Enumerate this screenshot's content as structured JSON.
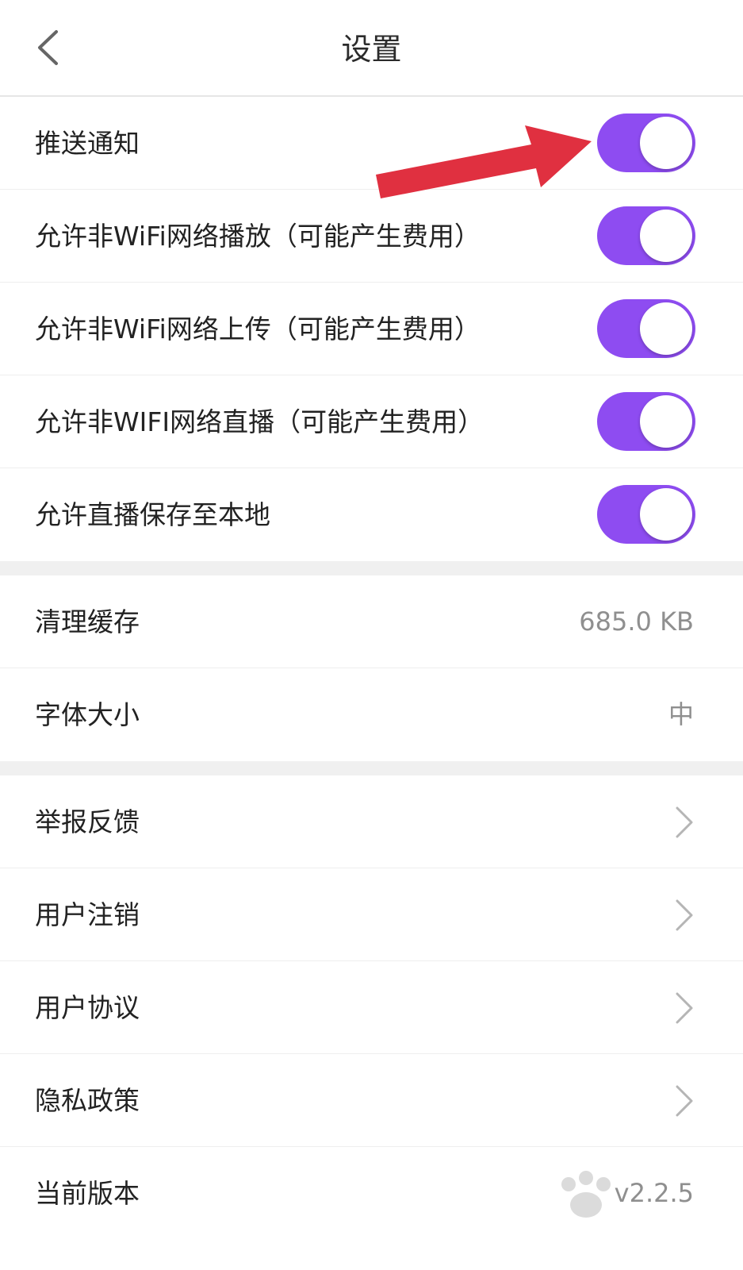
{
  "header": {
    "title": "设置"
  },
  "toggles": [
    {
      "label": "推送通知",
      "on": true
    },
    {
      "label": "允许非WiFi网络播放（可能产生费用）",
      "on": true
    },
    {
      "label": "允许非WiFi网络上传（可能产生费用）",
      "on": true
    },
    {
      "label": "允许非WIFI网络直播（可能产生费用）",
      "on": true
    },
    {
      "label": "允许直播保存至本地",
      "on": true
    }
  ],
  "settings": {
    "clear_cache": {
      "label": "清理缓存",
      "value": "685.0 KB"
    },
    "font_size": {
      "label": "字体大小",
      "value": "中"
    }
  },
  "links": [
    {
      "label": "举报反馈"
    },
    {
      "label": "用户注销"
    },
    {
      "label": "用户协议"
    },
    {
      "label": "隐私政策"
    }
  ],
  "version": {
    "label": "当前版本",
    "value": "v2.2.5"
  },
  "colors": {
    "accent": "#8e4cf1",
    "annotation_arrow": "#e03040"
  },
  "icons": {
    "back": "chevron-left-icon",
    "row_chevron": "chevron-right-icon",
    "annotation": "red-arrow-icon"
  }
}
